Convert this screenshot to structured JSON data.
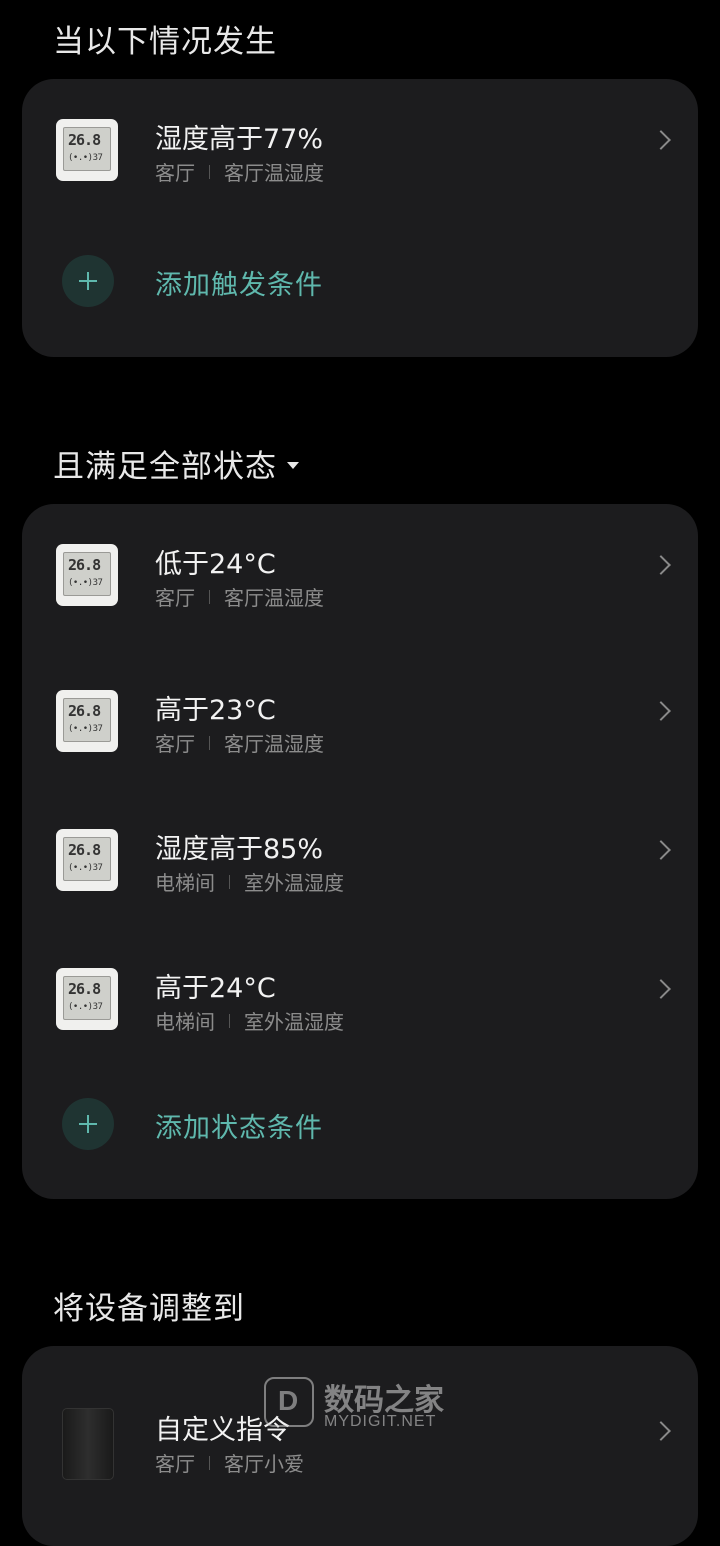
{
  "trigger_section": {
    "title": "当以下情况发生",
    "items": [
      {
        "title": "湿度高于77%",
        "room": "客厅",
        "device": "客厅温湿度",
        "screen_big": "26.8",
        "screen_small": "(•.•)37"
      }
    ],
    "add_label": "添加触发条件"
  },
  "state_section": {
    "title": "且满足全部状态",
    "items": [
      {
        "title": "低于24°C",
        "room": "客厅",
        "device": "客厅温湿度",
        "screen_big": "26.8",
        "screen_small": "(•.•)37"
      },
      {
        "title": "高于23°C",
        "room": "客厅",
        "device": "客厅温湿度",
        "screen_big": "26.8",
        "screen_small": "(•.•)37"
      },
      {
        "title": "湿度高于85%",
        "room": "电梯间",
        "device": "室外温湿度",
        "screen_big": "26.8",
        "screen_small": "(•.•)37"
      },
      {
        "title": "高于24°C",
        "room": "电梯间",
        "device": "室外温湿度",
        "screen_big": "26.8",
        "screen_small": "(•.•)37"
      }
    ],
    "add_label": "添加状态条件"
  },
  "action_section": {
    "title": "将设备调整到",
    "items": [
      {
        "title": "自定义指令",
        "room": "客厅",
        "device": "客厅小爱"
      }
    ]
  },
  "watermark": {
    "logo_letter": "D",
    "cn": "数码之家",
    "en": "MYDIGIT.NET"
  },
  "colors": {
    "background": "#000000",
    "card": "#1c1c1e",
    "accent": "#5fb8ad"
  }
}
